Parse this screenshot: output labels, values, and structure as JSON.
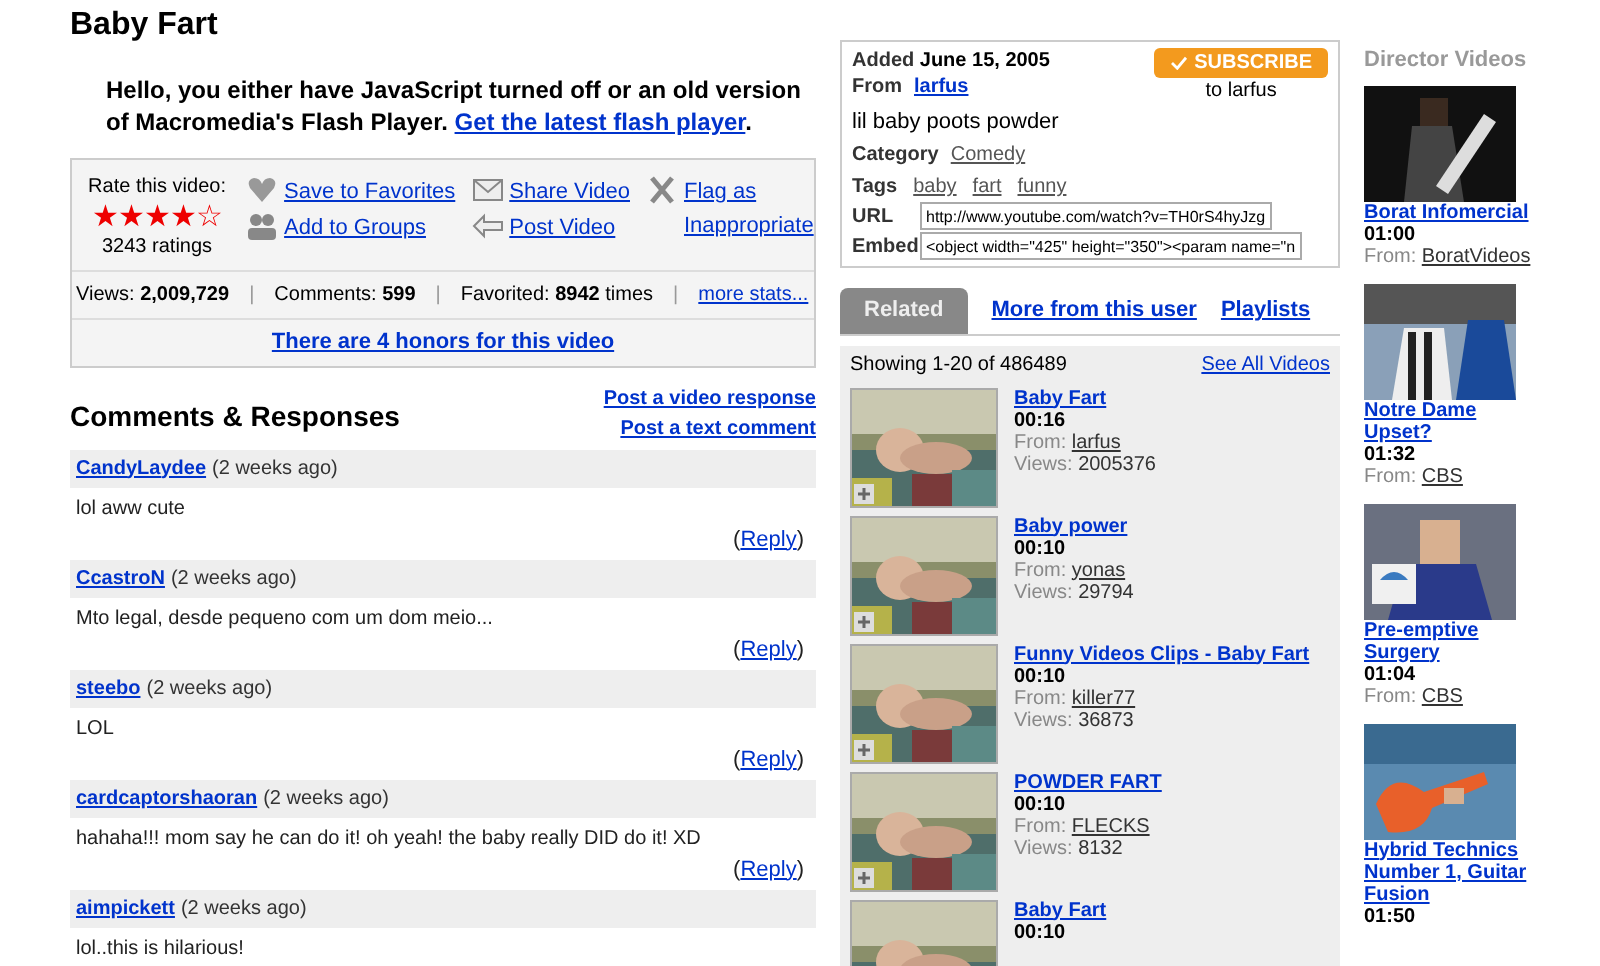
{
  "title": "Baby Fart",
  "flash_notice": {
    "text": "Hello, you either have JavaScript turned off or an old version of Macromedia's Flash Player.",
    "link": "Get the latest flash player",
    "end": "."
  },
  "rating": {
    "label": "Rate this video:",
    "stars": 4,
    "count": "3243 ratings"
  },
  "actions": [
    {
      "kind": "heart",
      "label": "Save to Favorites"
    },
    {
      "kind": "group",
      "label": "Add to Groups"
    },
    {
      "kind": "mail",
      "label": "Share Video"
    },
    {
      "kind": "post",
      "label": "Post Video"
    },
    {
      "kind": "flag",
      "label": "Flag as Inappropriate"
    }
  ],
  "stats": [
    {
      "label": "Views:",
      "value": "2,009,729",
      "separator": "|"
    },
    {
      "label": "Comments:",
      "value": "599",
      "separator": "|"
    },
    {
      "label": "Favorited:",
      "value": "8942",
      "suffix": "times",
      "separator": "|"
    }
  ],
  "more_stats": "more stats...",
  "honors": "There are 4 honors for this video",
  "comments_title": "Comments & Responses",
  "post_links": [
    "Post a video response",
    "Post a text comment"
  ],
  "comments": [
    {
      "user": "CandyLaydee",
      "time": "(2 weeks ago)",
      "text": "lol aww cute",
      "reply": {
        "open": "(",
        "label": "Reply",
        "close": ")"
      }
    },
    {
      "user": "CcastroN",
      "time": "(2 weeks ago)",
      "text": "Mto legal, desde pequeno com um dom meio...",
      "reply": {
        "open": "(",
        "label": "Reply",
        "close": ")"
      }
    },
    {
      "user": "steebo",
      "time": "(2 weeks ago)",
      "text": "LOL",
      "reply": {
        "open": "(",
        "label": "Reply",
        "close": ")"
      }
    },
    {
      "user": "cardcaptorshaoran",
      "time": "(2 weeks ago)",
      "text": "hahaha!!! mom say he can do it! oh yeah! the baby really DID do it! XD",
      "reply": {
        "open": "(",
        "label": "Reply",
        "close": ")"
      }
    },
    {
      "user": "aimpickett",
      "time": "(2 weeks ago)",
      "text": "lol..this is hilarious!"
    }
  ],
  "info": {
    "added_label": "Added",
    "added": "June 15, 2005",
    "from_label": "From",
    "from": "larfus",
    "subscribe": "SUBSCRIBE",
    "subscribe_to": "to larfus",
    "description": "lil baby poots powder",
    "category_label": "Category",
    "category": "Comedy",
    "tags_label": "Tags",
    "tags": [
      "baby",
      "fart",
      "funny"
    ],
    "url_label": "URL",
    "url": "http://www.youtube.com/watch?v=TH0rS4hyJzg",
    "embed_label": "Embed",
    "embed": "<object width=\"425\" height=\"350\"><param name=\"n"
  },
  "tabs": [
    {
      "label": "Related",
      "selected": true
    },
    {
      "label": "More from this user",
      "selected": false
    },
    {
      "label": "Playlists",
      "selected": false
    }
  ],
  "related": {
    "showing": "Showing 1-20 of 486489",
    "see_all": "See All Videos",
    "items": [
      {
        "title": "Baby Fart",
        "duration": "00:16",
        "from_label": "From:",
        "from": "larfus",
        "views_label": "Views:",
        "views": "2005376"
      },
      {
        "title": "Baby power",
        "duration": "00:10",
        "from_label": "From:",
        "from": "yonas",
        "views_label": "Views:",
        "views": "29794"
      },
      {
        "title": "Funny Videos Clips - Baby Fart",
        "duration": "00:10",
        "from_label": "From:",
        "from": "killer77",
        "views_label": "Views:",
        "views": "36873"
      },
      {
        "title": "POWDER FART",
        "duration": "00:10",
        "from_label": "From:",
        "from": "FLECKS",
        "views_label": "Views:",
        "views": "8132"
      },
      {
        "title": "Baby Fart",
        "duration": "00:10"
      }
    ]
  },
  "director": {
    "title": "Director Videos",
    "items": [
      {
        "title": "Borat Infomercial",
        "duration": "01:00",
        "from_label": "From:",
        "from": "BoratVideos"
      },
      {
        "title": "Notre Dame Upset?",
        "duration": "01:32",
        "from_label": "From:",
        "from": "CBS"
      },
      {
        "title": "Pre-emptive Surgery",
        "duration": "01:04",
        "from_label": "From:",
        "from": "CBS"
      },
      {
        "title": "Hybrid Technics Number 1, Guitar Fusion",
        "duration": "01:50"
      }
    ]
  }
}
